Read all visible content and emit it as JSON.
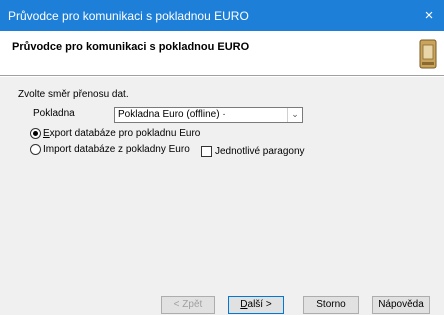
{
  "window": {
    "title": "Průvodce pro komunikaci s pokladnou EURO",
    "close_symbol": "×"
  },
  "header": {
    "title": "Průvodce pro komunikaci s pokladnou EURO"
  },
  "form": {
    "direction_label": "Zvolte směr přenosu dat.",
    "register_label": "Pokladna",
    "register_value": "Pokladna Euro (offline) ·",
    "export_label_first": "E",
    "export_label_rest": "xport databáze pro pokladnu Euro",
    "export_checked": true,
    "import_label": "Import databáze z pokladny Euro",
    "import_checked": false,
    "receipts_label": "Jednotlivé paragony",
    "receipts_checked": false
  },
  "buttons": {
    "back_label": "< Zpět",
    "next_first": "D",
    "next_rest": "alší >",
    "cancel_label": "Storno",
    "help_label": "Nápověda"
  },
  "colors": {
    "titlebar": "#1d7fd8",
    "panel": "#f0f0f0",
    "accent": "#0078d7"
  },
  "icons": {
    "header_icon": "cash-register-icon",
    "combo_arrow": "chevron-down-icon",
    "close": "close-icon"
  }
}
